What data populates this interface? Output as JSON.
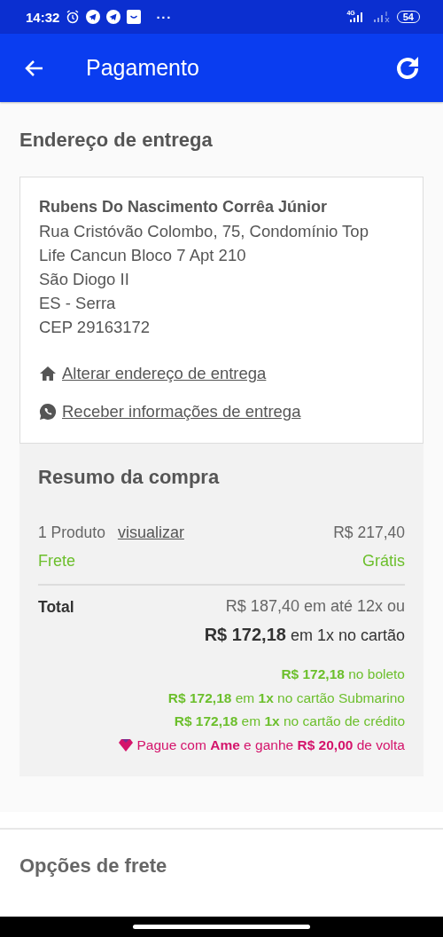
{
  "status_bar": {
    "time": "14:32",
    "more": "···",
    "network": "4G",
    "battery": "54"
  },
  "app_bar": {
    "title": "Pagamento"
  },
  "delivery": {
    "heading": "Endereço de entrega",
    "name": "Rubens Do Nascimento Corrêa Júnior",
    "address_lines": [
      "Rua Cristóvão Colombo, 75, Condomínio Top",
      "Life Cancun Bloco 7 Apt 210",
      "São Diogo II",
      "ES - Serra",
      "CEP 29163172"
    ],
    "links": [
      {
        "kind": "home",
        "label": "Alterar endereço de entrega"
      },
      {
        "kind": "whatsapp",
        "label": "Receber informações de entrega"
      }
    ]
  },
  "summary": {
    "title": "Resumo da compra",
    "product": {
      "label": "1 Produto",
      "link": "visualizar",
      "price": "R$ 217,40"
    },
    "shipping": {
      "label": "Frete",
      "value": "Grátis"
    },
    "total": {
      "label": "Total",
      "installments": "R$ 187,40 em até 12x ou",
      "single": "**R$ 172,18** em 1x no cartão"
    },
    "offers": [
      {
        "kind": "discount",
        "text": "**R$ 172,18** no boleto"
      },
      {
        "kind": "discount",
        "text": "**R$ 172,18** em **1x** no cartão Submarino"
      },
      {
        "kind": "discount",
        "text": "**R$ 172,18** em **1x** no cartão de crédito"
      },
      {
        "kind": "cashback",
        "text": "Pague com **Ame** e ganhe **R$ 20,00** de volta"
      }
    ]
  },
  "shipping_options": {
    "heading": "Opções de frete"
  }
}
